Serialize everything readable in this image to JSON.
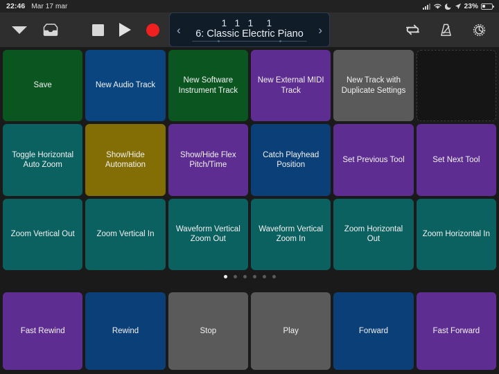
{
  "statusbar": {
    "time": "22:46",
    "date": "Mar 17 mar",
    "battery_percent": "23%",
    "icons": [
      "cellular-signal-icon",
      "wifi-icon",
      "do-not-disturb-icon",
      "location-arrow-icon",
      "battery-icon"
    ]
  },
  "toolbar": {
    "left_icons": [
      {
        "name": "chevron-down-icon",
        "label": "Hide Controls"
      },
      {
        "name": "tray-icon",
        "label": "Mixer View"
      }
    ],
    "transport_icons": [
      {
        "name": "stop-icon",
        "label": "Stop"
      },
      {
        "name": "play-icon",
        "label": "Play"
      },
      {
        "name": "record-icon",
        "label": "Record"
      }
    ],
    "right_icons": [
      {
        "name": "cycle-icon",
        "label": "Cycle"
      },
      {
        "name": "metronome-icon",
        "label": "Metronome"
      },
      {
        "name": "gear-icon",
        "label": "Settings"
      }
    ]
  },
  "lcd": {
    "prev_arrow": "‹",
    "next_arrow": "›",
    "position": {
      "bars": "1",
      "beats": "1",
      "divisions": "1",
      "ticks": "1"
    },
    "track_name": "6: Classic Electric Piano"
  },
  "colors": {
    "green": "#0a5520",
    "blue": "#0a4580",
    "purple": "#5e2d92",
    "gray": "#5a5a5a",
    "teal": "#0b6060",
    "gold": "#836e05",
    "blue_dark": "#0b3f78",
    "empty": "#151515",
    "background": "#1a1a1a",
    "toolbar": "#2e2e2e",
    "lcd": "#101c28",
    "record": "#f02020"
  },
  "pads": [
    {
      "label": "Save",
      "color": "#0a5520"
    },
    {
      "label": "New Audio Track",
      "color": "#0a4580"
    },
    {
      "label": "New Software Instrument Track",
      "color": "#0a5520"
    },
    {
      "label": "New External MIDI Track",
      "color": "#5e2d92"
    },
    {
      "label": "New Track with Duplicate Settings",
      "color": "#5a5a5a"
    },
    {
      "label": "",
      "color": "#151515",
      "empty": true
    },
    {
      "label": "Toggle Horizontal Auto Zoom",
      "color": "#0b6060"
    },
    {
      "label": "Show/Hide Automation",
      "color": "#836e05"
    },
    {
      "label": "Show/Hide Flex Pitch/Time",
      "color": "#5e2d92"
    },
    {
      "label": "Catch Playhead Position",
      "color": "#0b3f78"
    },
    {
      "label": "Set Previous Tool",
      "color": "#5e2d92"
    },
    {
      "label": "Set Next Tool",
      "color": "#5e2d92"
    },
    {
      "label": "Zoom Vertical Out",
      "color": "#0b6060"
    },
    {
      "label": "Zoom Vertical In",
      "color": "#0b6060"
    },
    {
      "label": "Waveform Vertical Zoom Out",
      "color": "#0b6060"
    },
    {
      "label": "Waveform Vertical Zoom In",
      "color": "#0b6060"
    },
    {
      "label": "Zoom Horizontal Out",
      "color": "#0b6060"
    },
    {
      "label": "Zoom Horizontal In",
      "color": "#0b6060"
    }
  ],
  "pagination": {
    "count": 6,
    "active_index": 0
  },
  "transport_pads": [
    {
      "label": "Fast Rewind",
      "color": "#5e2d92"
    },
    {
      "label": "Rewind",
      "color": "#0b3f78"
    },
    {
      "label": "Stop",
      "color": "#5a5a5a"
    },
    {
      "label": "Play",
      "color": "#5a5a5a"
    },
    {
      "label": "Forward",
      "color": "#0b3f78"
    },
    {
      "label": "Fast Forward",
      "color": "#5e2d92"
    }
  ]
}
